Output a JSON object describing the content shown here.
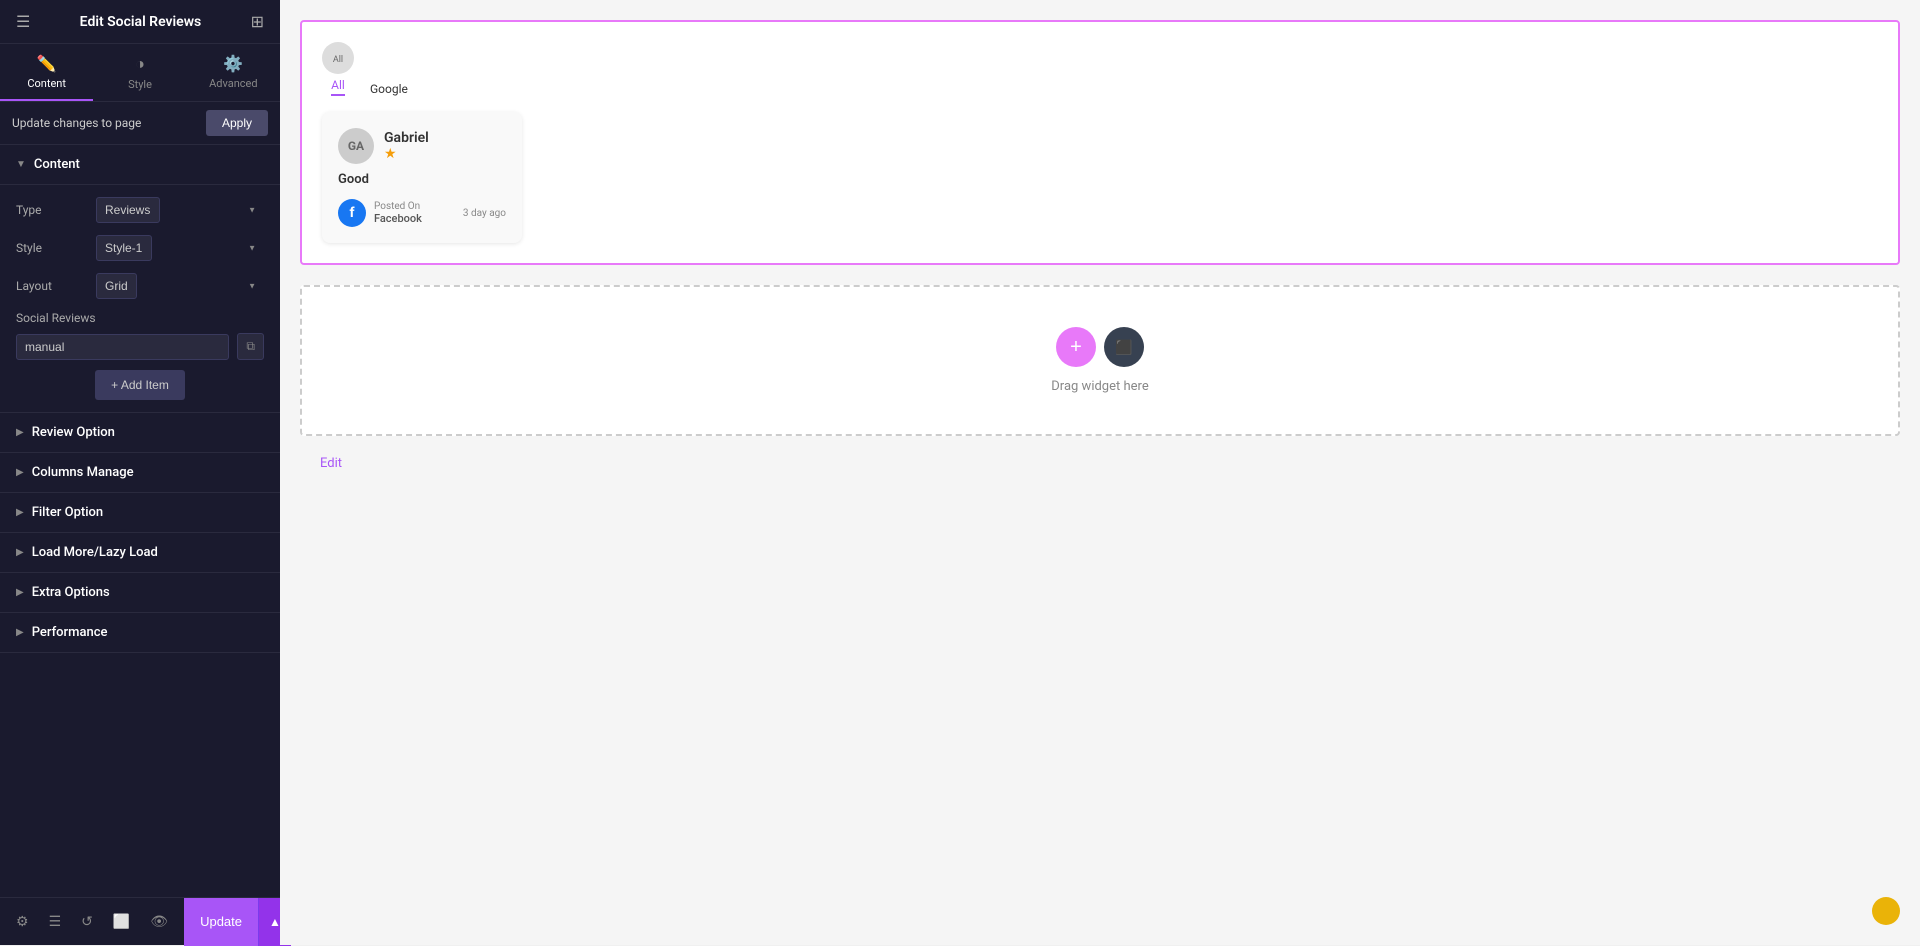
{
  "sidebar": {
    "title": "Edit Social Reviews",
    "tabs": [
      {
        "id": "content",
        "label": "Content",
        "icon": "✏️",
        "active": true
      },
      {
        "id": "style",
        "label": "Style",
        "icon": "◑",
        "active": false
      },
      {
        "id": "advanced",
        "label": "Advanced",
        "icon": "⚙️",
        "active": false
      }
    ],
    "update_bar": {
      "text": "Update changes to page",
      "apply_label": "Apply"
    },
    "content_section": {
      "label": "Content",
      "fields": [
        {
          "id": "type",
          "label": "Type",
          "value": "Reviews"
        },
        {
          "id": "style",
          "label": "Style",
          "value": "Style-1"
        },
        {
          "id": "layout",
          "label": "Layout",
          "value": "Grid"
        }
      ],
      "social_reviews_label": "Social Reviews",
      "social_reviews_value": "manual",
      "add_item_label": "+ Add Item"
    },
    "sections": [
      {
        "id": "review-option",
        "label": "Review Option"
      },
      {
        "id": "columns-manage",
        "label": "Columns Manage"
      },
      {
        "id": "filter-option",
        "label": "Filter Option"
      },
      {
        "id": "load-more",
        "label": "Load More/Lazy Load"
      },
      {
        "id": "extra-options",
        "label": "Extra Options"
      },
      {
        "id": "performance",
        "label": "Performance"
      }
    ],
    "toolbar": {
      "update_label": "Update",
      "chevron": "▲"
    }
  },
  "main": {
    "review_widget": {
      "tabs": [
        {
          "id": "all",
          "label": "All",
          "active": true
        },
        {
          "id": "google",
          "label": "Google",
          "active": false
        }
      ],
      "review_card": {
        "reviewer_name": "Gabriel",
        "reviewer_initials": "GA",
        "rating": "★",
        "review_text": "Good",
        "source": "Posted On Facebook",
        "date": "3 day ago",
        "platform": "f"
      }
    },
    "drop_zone": {
      "text": "Drag widget here"
    },
    "edit_link": "Edit"
  }
}
